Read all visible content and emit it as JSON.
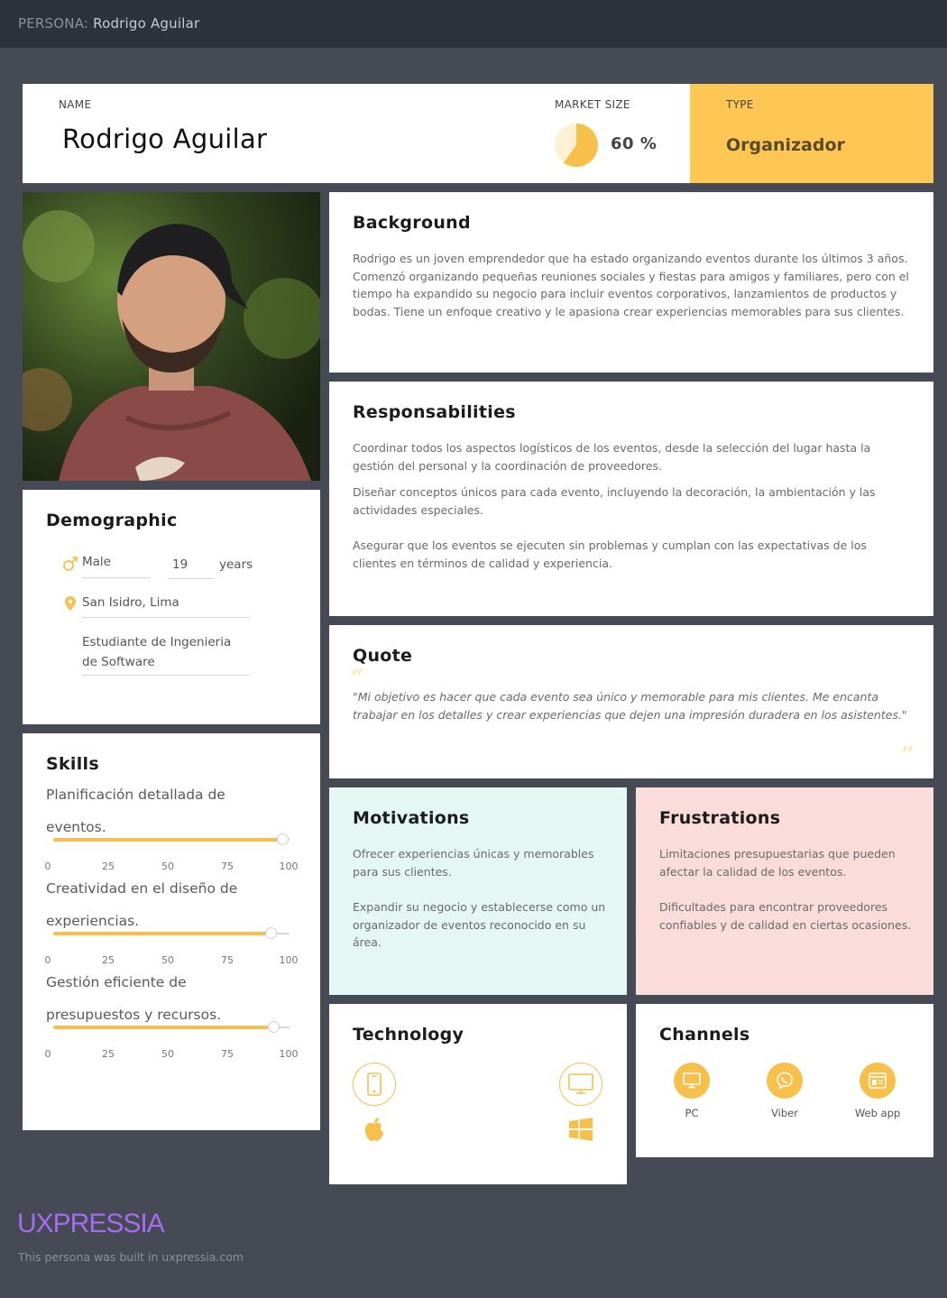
{
  "header": {
    "label": "PERSONA:",
    "name": "Rodrigo Aguilar"
  },
  "profile": {
    "name_label": "NAME",
    "name": "Rodrigo Aguilar",
    "market_label": "MARKET SIZE",
    "market_value": "60 %",
    "market_fraction": 0.6,
    "type_label": "TYPE",
    "type_value": "Organizador"
  },
  "background": {
    "title": "Background",
    "text": "Rodrigo es un joven emprendedor que ha estado organizando eventos durante los últimos 3 años. Comenzó organizando pequeñas reuniones sociales y fiestas para amigos y familiares, pero con el tiempo ha expandido su negocio para incluir eventos corporativos, lanzamientos de productos y bodas. Tiene un enfoque creativo y le apasiona crear experiencias memorables para sus clientes."
  },
  "responsibilities": {
    "title": "Responsabilities",
    "items": [
      "Coordinar todos los aspectos logísticos de los eventos, desde la selección del lugar hasta la gestión del personal y la coordinación de proveedores.",
      "Diseñar conceptos únicos para cada evento, incluyendo la decoración, la ambientación y las actividades especiales.",
      "Asegurar que los eventos se ejecuten sin problemas y cumplan con las expectativas de los clientes en términos de calidad y experiencia."
    ]
  },
  "demographic": {
    "title": "Demographic",
    "gender": "Male",
    "age": "19",
    "age_unit": "years",
    "location": "San Isidro, Lima",
    "occupation": "Estudiante de Ingenieria de Software"
  },
  "quote": {
    "title": "Quote",
    "text": "\"Mi objetivo es hacer que cada evento sea único y memorable para mis clientes. Me encanta trabajar en los detalles y crear experiencias que dejen una impresión duradera en los asistentes.\""
  },
  "skills": {
    "title": "Skills",
    "ticks": [
      "0",
      "25",
      "50",
      "75",
      "100"
    ],
    "items": [
      {
        "label": "Planificación detallada de eventos.",
        "value": 97
      },
      {
        "label": "Creatividad en el diseño de experiencias.",
        "value": 92
      },
      {
        "label": "Gestión eficiente de presupuestos y recursos.",
        "value": 93
      }
    ]
  },
  "motivations": {
    "title": "Motivations",
    "items": [
      "Ofrecer experiencias únicas y memorables para sus clientes.",
      "Expandir su negocio y establecerse como un organizador de eventos reconocido en su área."
    ]
  },
  "frustrations": {
    "title": "Frustrations",
    "items": [
      "Limitaciones presupuestarias que pueden afectar la calidad de los eventos.",
      "Dificultades para encontrar proveedores confiables y de calidad en ciertas ocasiones."
    ]
  },
  "technology": {
    "title": "Technology",
    "icons": [
      "smartphone-icon",
      "apple-icon",
      "monitor-icon",
      "windows-icon"
    ]
  },
  "channels": {
    "title": "Channels",
    "items": [
      {
        "label": "PC",
        "icon": "monitor-icon"
      },
      {
        "label": "Viber",
        "icon": "viber-icon"
      },
      {
        "label": "Web app",
        "icon": "web-app-icon"
      }
    ]
  },
  "footer": {
    "brand": "UXPRESSIA",
    "note": "This persona was built in uxpressia.com"
  },
  "colors": {
    "accent": "#f6c04b",
    "page_bg": "#464a55",
    "topbar_bg": "#2e323c",
    "motivations_bg": "#e4f7f3",
    "frustrations_bg": "#fadcda",
    "brand": "#a66cf0"
  }
}
